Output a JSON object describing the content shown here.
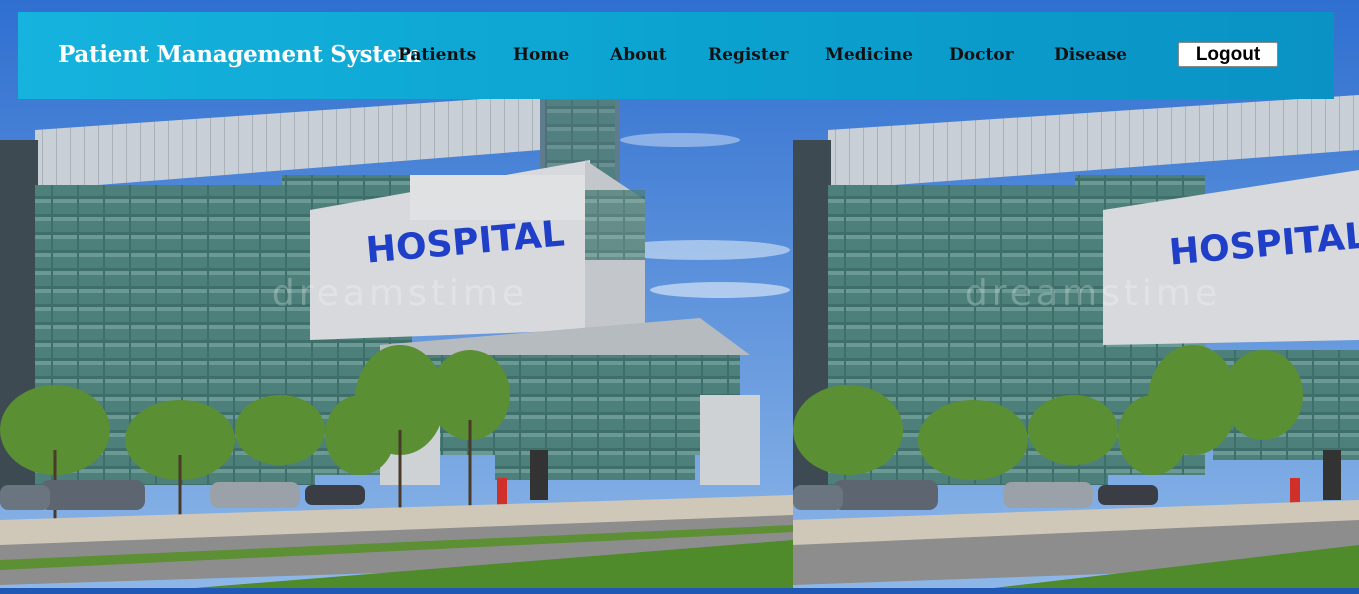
{
  "navbar": {
    "brand": "Patient Management System",
    "links": [
      {
        "label": "Patients"
      },
      {
        "label": "Home"
      },
      {
        "label": "About"
      },
      {
        "label": "Register"
      },
      {
        "label": "Medicine"
      },
      {
        "label": "Doctor"
      },
      {
        "label": "Disease"
      }
    ],
    "logout_label": "Logout"
  },
  "background": {
    "building_sign": "HOSPITAL",
    "watermark": "dreamstime",
    "colors": {
      "sky": "#3b7fd6",
      "navbar_start": "#15b3dd",
      "navbar_end": "#0a92c4",
      "glass": "#3f6f6a",
      "concrete": "#d7d9dc",
      "sign": "#1f3fc8",
      "grass": "#4f8a2b",
      "road": "#8d8d8d"
    }
  }
}
